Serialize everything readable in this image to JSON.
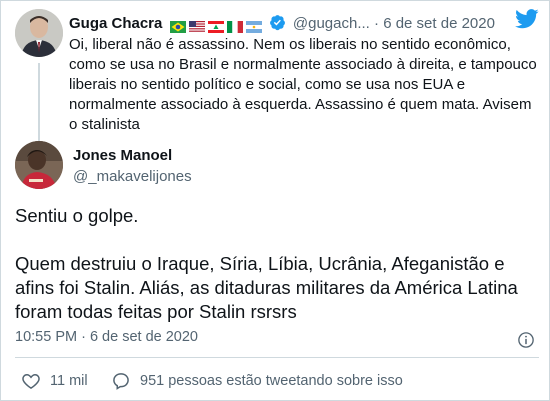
{
  "parent_tweet": {
    "author_name": "Guga Chacra",
    "handle": "@gugach...",
    "separator": "·",
    "date": "6 de set de 2020",
    "flags": [
      "brazil-flag-icon",
      "usa-flag-icon",
      "lebanon-flag-icon",
      "italy-flag-icon",
      "argentina-flag-icon"
    ],
    "text": "Oi, liberal não é assassino. Nem os liberais no sentido econômico, como se usa no Brasil e normalmente associado à direita, e tampouco liberais no sentido político e social, como se usa nos EUA e normalmente associado à esquerda. Assassino é quem mata. Avisem o stalinista"
  },
  "main_tweet": {
    "author_name": "Jones Manoel",
    "handle": "@_makavelijones",
    "paragraphs": [
      "Sentiu o golpe.",
      "Quem destruiu o Iraque, Síria, Líbia, Ucrânia, Afeganistão e afins foi Stalin. Aliás, as ditaduras militares da América Latina foram todas feitas por Stalin rsrsrs"
    ],
    "timestamp": "10:55 PM · 6 de set de 2020",
    "likes": "11 mil",
    "conversation": "951 pessoas estão tweetando sobre isso"
  },
  "colors": {
    "text": "#0f1419",
    "secondary": "#536471",
    "border": "#cfd9de",
    "twitter_blue": "#1d9bf0"
  }
}
